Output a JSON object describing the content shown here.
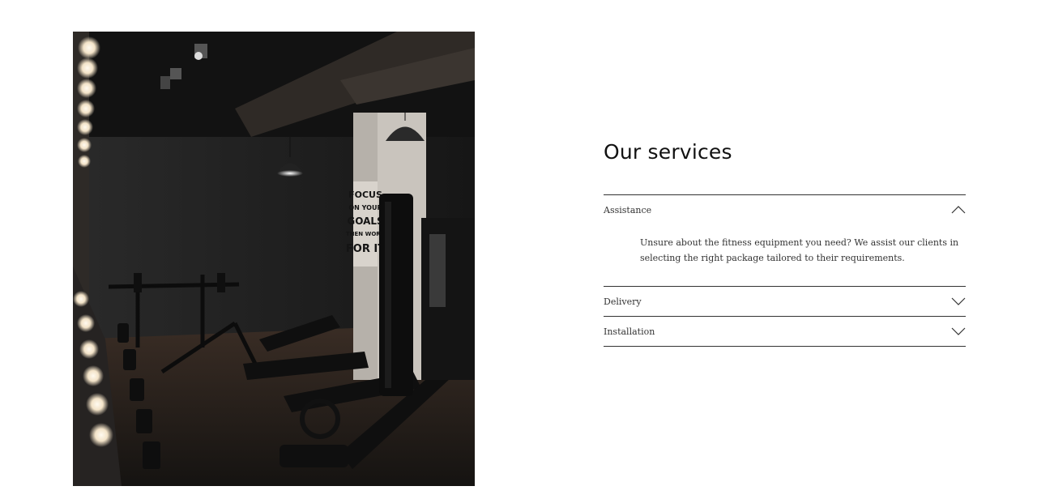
{
  "photo": {
    "alt_icon": "gym-photo",
    "poster_lines": [
      "FOCUS",
      "ON YOUR",
      "GOALS",
      "THEN WORK",
      "FOR IT"
    ]
  },
  "services": {
    "title": "Our services",
    "items": [
      {
        "label": "Assistance",
        "expanded": true,
        "icon": "chevron-up-icon",
        "body": "Unsure about the fitness equipment you need? We assist our clients in selecting the right package tailored to their requirements."
      },
      {
        "label": "Delivery",
        "expanded": false,
        "icon": "chevron-down-icon"
      },
      {
        "label": "Installation",
        "expanded": false,
        "icon": "chevron-down-icon"
      }
    ]
  },
  "colors": {
    "rule": "#333333",
    "text": "#222222",
    "photo_bg": "#1b1b1b"
  }
}
